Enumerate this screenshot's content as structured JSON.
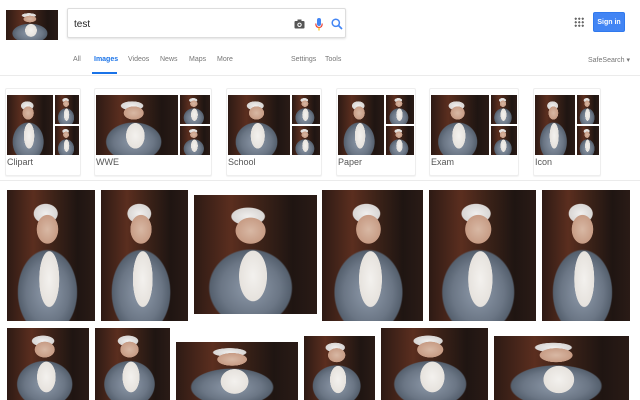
{
  "search": {
    "query": "test"
  },
  "header": {
    "sign_in_label": "Sign in"
  },
  "tabs": [
    {
      "label": "All",
      "active": false
    },
    {
      "label": "Images",
      "active": true
    },
    {
      "label": "Videos",
      "active": false
    },
    {
      "label": "News",
      "active": false
    },
    {
      "label": "Maps",
      "active": false
    },
    {
      "label": "More",
      "active": false
    }
  ],
  "tools": {
    "settings_label": "Settings",
    "tools_label": "Tools",
    "safesearch_label": "SafeSearch ▾"
  },
  "related": [
    {
      "label": "Clipart"
    },
    {
      "label": "WWE"
    },
    {
      "label": "School"
    },
    {
      "label": "Paper"
    },
    {
      "label": "Exam"
    },
    {
      "label": "Icon"
    }
  ],
  "colors": {
    "accent": "#1a73e8",
    "signin_bg": "#4285f4",
    "mic_red": "#ea4335"
  }
}
